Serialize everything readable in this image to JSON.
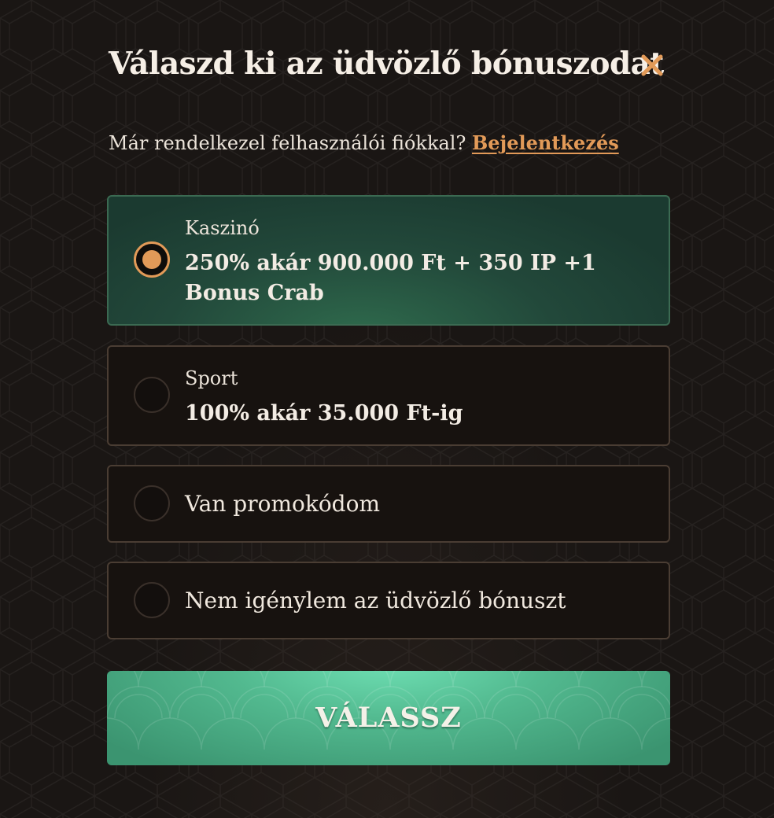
{
  "modal": {
    "title": "Válaszd ki az üdvözlő bónuszodat",
    "close_icon": "close-icon",
    "login_prompt": "Már rendelkezel felhasználói fiókkal?",
    "login_link": "Bejelentkezés"
  },
  "options": [
    {
      "label": "Kaszinó",
      "value": "250% akár 900.000 Ft + 350 IP +1 Bonus Crab",
      "selected": true
    },
    {
      "label": "Sport",
      "value": "100% akár 35.000 Ft-ig",
      "selected": false
    },
    {
      "label": "Van promokódom",
      "selected": false
    },
    {
      "label": "Nem igénylem az üdvözlő bónuszt",
      "selected": false
    }
  ],
  "cta": {
    "label": "VÁLASSZ"
  },
  "colors": {
    "accent": "#e29a58",
    "selected_bg": "#22483a",
    "cta_bg": "#52b98f",
    "page_bg": "#1a1614"
  }
}
